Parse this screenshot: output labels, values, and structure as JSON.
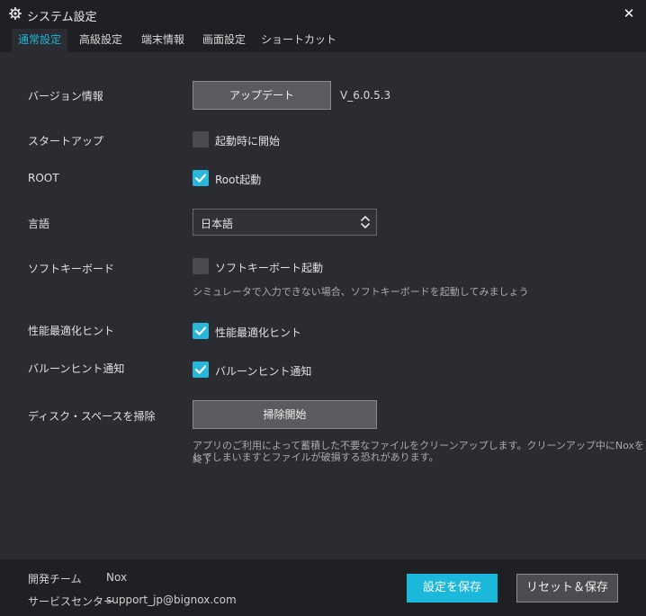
{
  "window": {
    "title": "システム設定",
    "close_symbol": "✕"
  },
  "tabs": [
    {
      "label": "通常設定",
      "active": true
    },
    {
      "label": "高級設定",
      "active": false
    },
    {
      "label": "端末情報",
      "active": false
    },
    {
      "label": "画面設定",
      "active": false
    },
    {
      "label": "ショートカット",
      "active": false
    }
  ],
  "settings": {
    "version": {
      "label": "バージョン情報",
      "button": "アップデート",
      "value": "V_6.0.5.3"
    },
    "startup": {
      "label": "スタートアップ",
      "checkbox": "起動時に開始",
      "checked": false
    },
    "root": {
      "label": "ROOT",
      "checkbox": "Root起動",
      "checked": true
    },
    "language": {
      "label": "言語",
      "selected": "日本語"
    },
    "soft_keyboard": {
      "label": "ソフトキーボード",
      "checkbox": "ソフトキーボート起動",
      "checked": false,
      "hint": "シミュレータで入力できない場合、ソフトキーボードを起動してみましょう"
    },
    "performance": {
      "label": "性能最適化ヒント",
      "checkbox": "性能最適化ヒント",
      "checked": true
    },
    "balloon": {
      "label": "バルーンヒント通知",
      "checkbox": "バルーンヒント通知",
      "checked": true
    },
    "disk": {
      "label": "ディスク・スペースを掃除",
      "button": "掃除開始",
      "hint_line1": "アプリのご利用によって蓄積した不要なファイルをクリーンアップします。クリーンアップ中にNoxを終了",
      "hint_line2": "してしまいますとファイルが破損する恐れがあります。"
    }
  },
  "footer": {
    "dev_team_label": "開発チーム",
    "dev_team_value": "Nox",
    "service_label": "サービスセンター",
    "service_value": "support_jp@bignox.com",
    "save_button": "設定を保存",
    "reset_button": "リセット＆保存"
  },
  "colors": {
    "accent": "#1cb8dc",
    "background": "#2b2c31",
    "chrome": "#1f2024"
  }
}
